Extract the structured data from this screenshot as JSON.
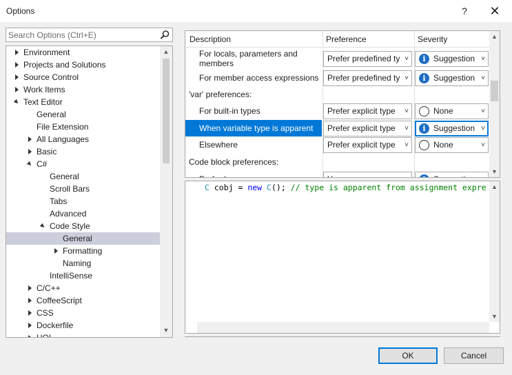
{
  "window": {
    "title": "Options",
    "help_glyph": "?",
    "close_glyph": "✕"
  },
  "search": {
    "placeholder": "Search Options (Ctrl+E)",
    "value": ""
  },
  "tree": {
    "items": [
      {
        "label": "Environment",
        "expander": "collapsed"
      },
      {
        "label": "Projects and Solutions",
        "expander": "collapsed"
      },
      {
        "label": "Source Control",
        "expander": "collapsed"
      },
      {
        "label": "Work Items",
        "expander": "collapsed"
      },
      {
        "label": "Text Editor",
        "expander": "expanded"
      },
      {
        "label": "General",
        "expander": "none"
      },
      {
        "label": "File Extension",
        "expander": "none"
      },
      {
        "label": "All Languages",
        "expander": "collapsed"
      },
      {
        "label": "Basic",
        "expander": "collapsed"
      },
      {
        "label": "C#",
        "expander": "expanded"
      },
      {
        "label": "General",
        "expander": "none"
      },
      {
        "label": "Scroll Bars",
        "expander": "none"
      },
      {
        "label": "Tabs",
        "expander": "none"
      },
      {
        "label": "Advanced",
        "expander": "none"
      },
      {
        "label": "Code Style",
        "expander": "expanded"
      },
      {
        "label": "General",
        "expander": "none",
        "selected": true
      },
      {
        "label": "Formatting",
        "expander": "collapsed"
      },
      {
        "label": "Naming",
        "expander": "none"
      },
      {
        "label": "IntelliSense",
        "expander": "none"
      },
      {
        "label": "C/C++",
        "expander": "collapsed"
      },
      {
        "label": "CoffeeScript",
        "expander": "collapsed"
      },
      {
        "label": "CSS",
        "expander": "collapsed"
      },
      {
        "label": "Dockerfile",
        "expander": "collapsed"
      },
      {
        "label": "HOL",
        "expander": "collapsed"
      }
    ]
  },
  "grid": {
    "headers": {
      "description": "Description",
      "preference": "Preference",
      "severity": "Severity"
    },
    "rows": [
      {
        "type": "option",
        "description": "For locals, parameters and members",
        "preference": "Prefer predefined ty",
        "severity": "Suggestion",
        "severity_icon": "info-icon"
      },
      {
        "type": "option",
        "description": "For member access expressions",
        "preference": "Prefer predefined ty",
        "severity": "Suggestion",
        "severity_icon": "info-icon"
      },
      {
        "type": "group",
        "description": "'var' preferences:"
      },
      {
        "type": "option",
        "description": "For built-in types",
        "preference": "Prefer explicit type",
        "severity": "None",
        "severity_icon": "radio-icon"
      },
      {
        "type": "option",
        "description": "When variable type is apparent",
        "preference": "Prefer explicit type",
        "severity": "Suggestion",
        "severity_icon": "info-icon",
        "selected": true
      },
      {
        "type": "option",
        "description": "Elsewhere",
        "preference": "Prefer explicit type",
        "severity": "None",
        "severity_icon": "radio-icon"
      },
      {
        "type": "group",
        "description": "Code block preferences:"
      },
      {
        "type": "option",
        "description": "Prefer braces",
        "preference": "Yes",
        "severity": "Suggestion",
        "severity_icon": "info-icon"
      }
    ]
  },
  "preview": {
    "code_tokens": [
      {
        "text": "C",
        "kind": "type"
      },
      {
        "text": " cobj = ",
        "kind": "plain"
      },
      {
        "text": "new",
        "kind": "keyword"
      },
      {
        "text": " ",
        "kind": "plain"
      },
      {
        "text": "C",
        "kind": "type"
      },
      {
        "text": "(); ",
        "kind": "plain"
      },
      {
        "text": "// type is apparent from assignment expre",
        "kind": "comment"
      }
    ]
  },
  "buttons": {
    "ok": "OK",
    "cancel": "Cancel"
  },
  "colors": {
    "selection": "#0078d7",
    "tree_selection": "#cccedb",
    "info": "#1e6ec2",
    "keyword": "#0000ff",
    "type": "#2b91af",
    "comment": "#008000"
  }
}
